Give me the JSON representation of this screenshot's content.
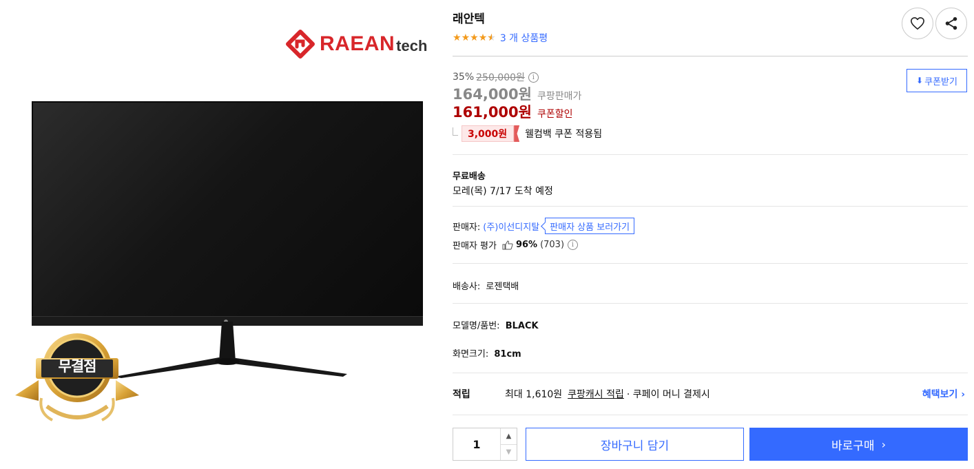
{
  "brand": {
    "name": "RAEAN",
    "name_suffix": "tech",
    "color": "#d8262a"
  },
  "badge": {
    "label": "무결점"
  },
  "product": {
    "title": "래안텍",
    "rating": 4.5,
    "review_text": "3 개 상품평"
  },
  "price": {
    "discount_rate": "35%",
    "original_price": "250,000원",
    "sale_price": "164,000원",
    "sale_label": "쿠팡판매가",
    "coupon_price": "161,000원",
    "coupon_label": "쿠폰할인",
    "welcome_coupon_amount": "3,000원",
    "welcome_coupon_text": "웰컴백 쿠폰 적용됨",
    "coupon_button": "쿠폰받기"
  },
  "shipping": {
    "title": "무료배송",
    "arrival": "모레(목) 7/17 도착 예정"
  },
  "seller": {
    "label": "판매자:",
    "name": "(주)이선디지탈",
    "link": "판매자 상품 보러가기",
    "eval_label": "판매자 평가",
    "eval_score": "96%",
    "eval_count": "(703)"
  },
  "delivery": {
    "label": "배송사:",
    "value": "로젠택배"
  },
  "specs": {
    "model_label": "모델명/품번:",
    "model_value": "BLACK",
    "screen_label": "화면크기:",
    "screen_value": "81cm"
  },
  "points": {
    "title": "적립",
    "text": "최대 1,610원",
    "link": "쿠팡캐시 적립",
    "suffix": "· 쿠페이 머니 결제시",
    "benefit_link": "혜택보기 ›"
  },
  "purchase": {
    "quantity": "1",
    "cart_button": "장바구니 담기",
    "buy_button": "바로구매"
  },
  "colors": {
    "accent_blue": "#346aff",
    "coupon_red": "#ae0000",
    "star_orange": "#f39a1c"
  },
  "icons": [
    "heart-icon",
    "share-icon",
    "info-icon",
    "download-icon",
    "thumb-up-icon",
    "chevron-up-icon",
    "chevron-down-icon",
    "chevron-right-icon"
  ]
}
